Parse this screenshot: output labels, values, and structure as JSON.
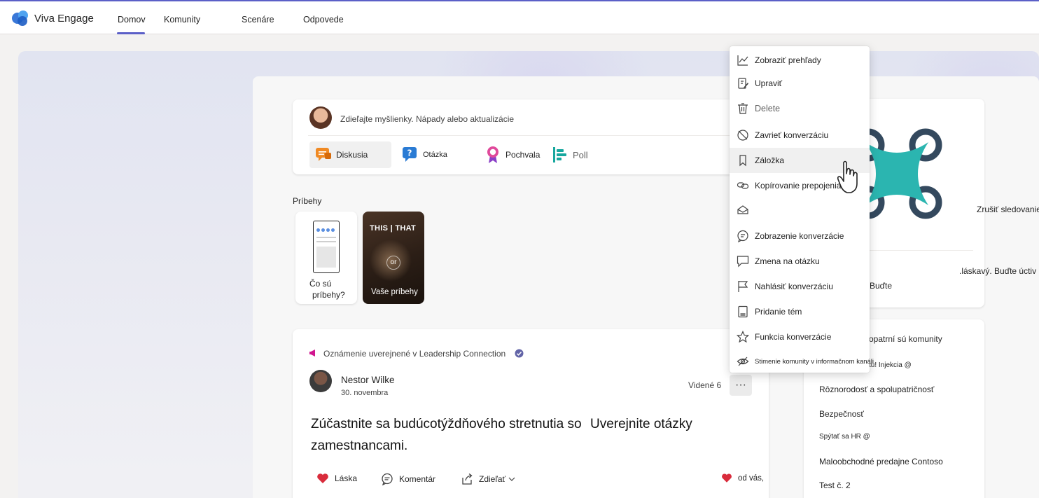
{
  "app": {
    "name": "Viva Engage"
  },
  "nav": {
    "tabs": [
      {
        "label": "Domov",
        "active": true
      },
      {
        "label": "Komunity"
      },
      {
        "label": "Scenáre"
      },
      {
        "label": "Odpovede"
      }
    ]
  },
  "composer": {
    "prompt": "Zdieľajte myšlienky. Nápady alebo aktualizácie",
    "types": [
      {
        "label": "Diskusia",
        "icon": "discussion-icon"
      },
      {
        "label": "Otázka",
        "icon": "question-icon"
      },
      {
        "label": "Pochvala",
        "icon": "praise-icon"
      },
      {
        "label": "Poll",
        "icon": "poll-icon"
      }
    ]
  },
  "stories": {
    "label": "Príbehy",
    "info_card": {
      "line1": "Čo sú",
      "line2": "príbehy?"
    },
    "your_card": {
      "overlay": "THIS | THAT",
      "mid": "or",
      "label": "Vaše príbehy"
    }
  },
  "post": {
    "announcement": "Oznámenie uverejnené v Leadership Connection",
    "author": "Nestor Wilke",
    "date": "30. novembra",
    "seen": "Videné 6",
    "more": "···",
    "body": "Zúčastnite sa budúcotýždňového stretnutia so zamestnancami.",
    "body_right": "Uverejnite otázky",
    "actions": {
      "like": "Láska",
      "comment": "Komentár",
      "share": "Zdieľať",
      "reaction": "od vás,"
    }
  },
  "right_panel": {
    "unfollow": "Zrušiť sledovanie",
    "kind_text": ".láskavý. Buďte úctiv",
    "be_text": "Buďte",
    "communities_title": "opatrní sú komunity",
    "communities": [
      "tu! Injekcia @",
      "Rôznorodosť a spolupatričnosť",
      "Bezpečnosť",
      "Spýtať sa HR @",
      "Maloobchodné predajne Contoso",
      "Test č. 2"
    ]
  },
  "menu": {
    "items": [
      {
        "label": "Zobraziť prehľady",
        "icon": "insights-icon"
      },
      {
        "label": "Upraviť",
        "icon": "edit-icon"
      },
      {
        "label": "Delete",
        "icon": "delete-icon"
      },
      {
        "label": "Zavrieť konverzáciu",
        "icon": "close-conversation-icon"
      },
      {
        "label": "Záložka",
        "icon": "bookmark-icon",
        "hover": true
      },
      {
        "label": "Kopírovanie prepojenia",
        "icon": "link-icon"
      },
      {
        "label": "",
        "icon": "mark-unread-icon"
      },
      {
        "label": "Zobrazenie konverzácie",
        "icon": "view-conversation-icon"
      },
      {
        "label": "Zmena na otázku",
        "icon": "change-to-question-icon"
      },
      {
        "label": "Nahlásiť konverzáciu",
        "icon": "report-flag-icon"
      },
      {
        "label": "Pridanie tém",
        "icon": "add-topics-icon"
      },
      {
        "label": "Funkcia konverzácie",
        "icon": "feature-star-icon"
      },
      {
        "label": "Stimenie komunity v informačnom kanáli",
        "icon": "mute-community-icon"
      }
    ]
  },
  "colors": {
    "accent": "#5b5fc7",
    "brand_teal": "#2bb5b0",
    "like_red": "#d92c3c"
  }
}
